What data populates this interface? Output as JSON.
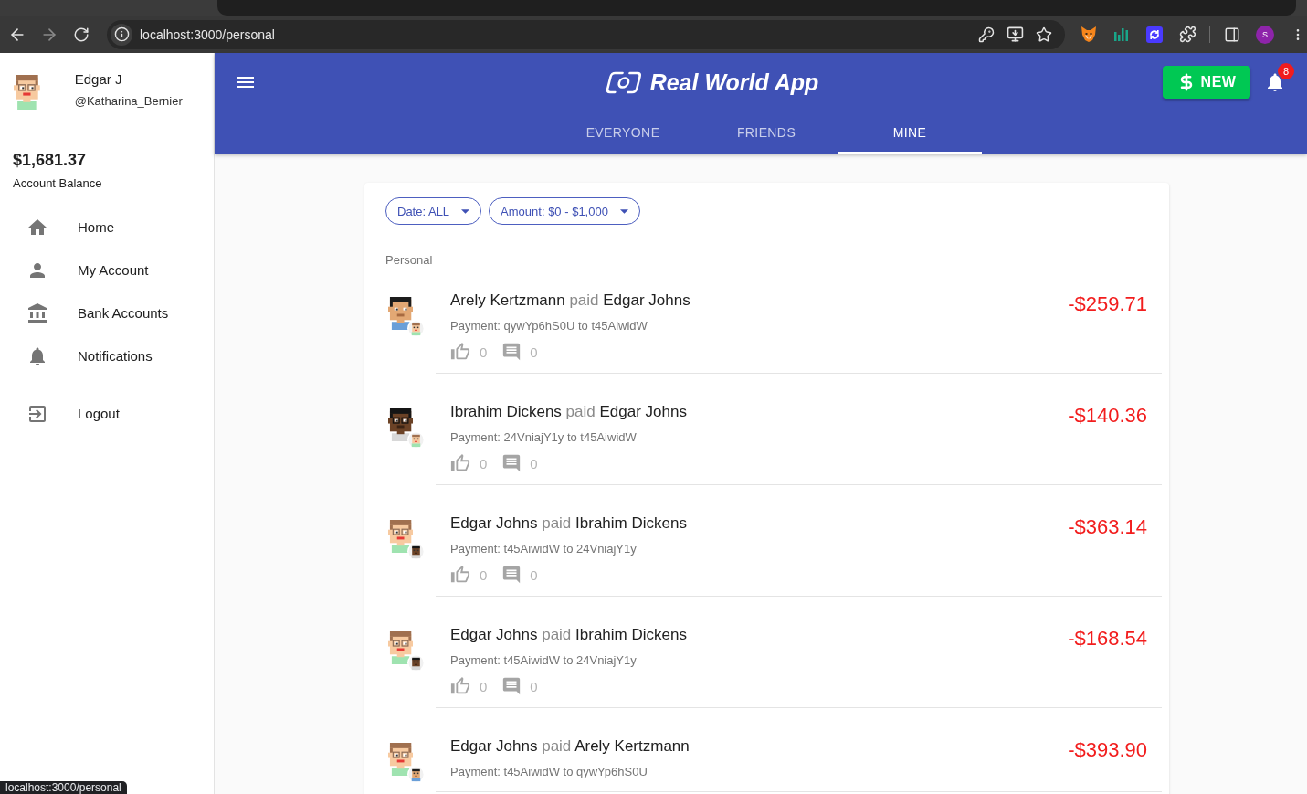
{
  "browser": {
    "url": "localhost:3000/personal",
    "profile_initial": "S",
    "status_url": "localhost:3000/personal"
  },
  "sidebar": {
    "user": {
      "name": "Edgar J",
      "username": "@Katharina_Bernier",
      "avatar": {
        "kind": "pale"
      }
    },
    "balance": {
      "amount": "$1,681.37",
      "label": "Account Balance"
    },
    "nav": [
      {
        "kind": "home",
        "label": "Home"
      },
      {
        "kind": "account",
        "label": "My Account"
      },
      {
        "kind": "bank",
        "label": "Bank Accounts"
      },
      {
        "kind": "notifications",
        "label": "Notifications"
      }
    ],
    "secondary_nav": [
      {
        "kind": "logout",
        "label": "Logout"
      }
    ]
  },
  "header": {
    "title": "Real World App",
    "new_button": "NEW",
    "notification_count": "8",
    "tabs": [
      {
        "label": "EVERYONE",
        "selected": false
      },
      {
        "label": "FRIENDS",
        "selected": false
      },
      {
        "label": "MINE",
        "selected": true
      }
    ]
  },
  "filters": [
    {
      "label": "Date: ALL"
    },
    {
      "label": "Amount: $0 - $1,000"
    }
  ],
  "list_heading": "Personal",
  "transactions": [
    {
      "sender": "Arely Kertzmann",
      "action": "paid",
      "receiver": "Edgar Johns",
      "description": "Payment: qywYp6hS0U to t45AiwidW",
      "likes": "0",
      "comments": "0",
      "amount": "-$259.71",
      "avatar": {
        "kind": "tan"
      },
      "small_avatar": {
        "kind": "pale"
      }
    },
    {
      "sender": "Ibrahim Dickens",
      "action": "paid",
      "receiver": "Edgar Johns",
      "description": "Payment: 24VniajY1y to t45AiwidW",
      "likes": "0",
      "comments": "0",
      "amount": "-$140.36",
      "avatar": {
        "kind": "dark"
      },
      "small_avatar": {
        "kind": "pale"
      }
    },
    {
      "sender": "Edgar Johns",
      "action": "paid",
      "receiver": "Ibrahim Dickens",
      "description": "Payment: t45AiwidW to 24VniajY1y",
      "likes": "0",
      "comments": "0",
      "amount": "-$363.14",
      "avatar": {
        "kind": "pale"
      },
      "small_avatar": {
        "kind": "dark"
      }
    },
    {
      "sender": "Edgar Johns",
      "action": "paid",
      "receiver": "Ibrahim Dickens",
      "description": "Payment: t45AiwidW to 24VniajY1y",
      "likes": "0",
      "comments": "0",
      "amount": "-$168.54",
      "avatar": {
        "kind": "pale"
      },
      "small_avatar": {
        "kind": "dark"
      }
    },
    {
      "sender": "Edgar Johns",
      "action": "paid",
      "receiver": "Arely Kertzmann",
      "description": "Payment: t45AiwidW to qywYp6hS0U",
      "amount": "-$393.90",
      "avatar": {
        "kind": "pale"
      },
      "small_avatar": {
        "kind": "tan"
      }
    }
  ]
}
